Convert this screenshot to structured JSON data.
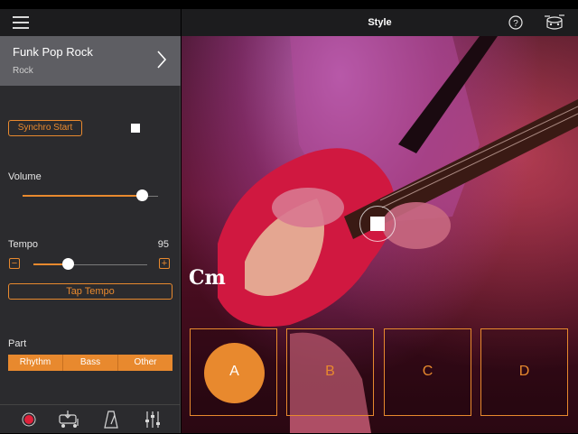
{
  "header": {
    "title": "Style"
  },
  "style_card": {
    "name": "Funk Pop Rock",
    "genre": "Rock"
  },
  "synchro": {
    "label": "Synchro Start",
    "enabled": false
  },
  "volume": {
    "label": "Volume",
    "level": 0.88
  },
  "tempo": {
    "label": "Tempo",
    "value": "95",
    "minus": "−",
    "plus": "+",
    "level": 0.3
  },
  "tap_tempo": {
    "label": "Tap Tempo"
  },
  "part": {
    "label": "Part",
    "options": [
      "Rhythm",
      "Bass",
      "Other"
    ]
  },
  "chord": {
    "name": "Cm"
  },
  "pads": [
    {
      "label": "A",
      "active": true
    },
    {
      "label": "B",
      "active": false
    },
    {
      "label": "C",
      "active": false
    },
    {
      "label": "D",
      "active": false
    }
  ],
  "colors": {
    "accent": "#e8892e",
    "sidebar": "#2b2b2e",
    "card": "#5e5e63",
    "record": "#e0203a"
  },
  "icons": [
    "hamburger-menu-icon",
    "chevron-right-icon",
    "help-icon",
    "drum-kit-icon",
    "record-icon",
    "audio-export-icon",
    "metronome-icon",
    "mixer-icon",
    "stop-icon"
  ]
}
